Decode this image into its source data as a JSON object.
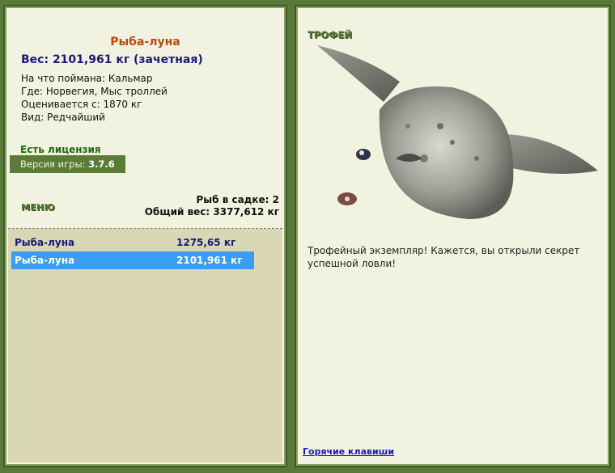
{
  "fish": {
    "name": "Рыба-луна",
    "weight_line": "Вес: 2101,961 кг (зачетная)",
    "bait_line": "На что поймана: Кальмар",
    "place_line": "Где: Норвегия, Мыс троллей",
    "value_line": "Оценивается с: 1870 кг",
    "kind_line": "Вид: Редчайший"
  },
  "license": "Есть лицензия",
  "version": {
    "label": "Версия игры:",
    "value": "3.7.6"
  },
  "menu_label": "МЕНЮ",
  "stats": {
    "fish_count": "Рыб в садке: 2",
    "total_weight": "Общий вес: 3377,612 кг"
  },
  "catch_list": [
    {
      "name": "Рыба-луна",
      "weight": "1275,65 кг",
      "selected": false
    },
    {
      "name": "Рыба-луна",
      "weight": "2101,961 кг",
      "selected": true
    }
  ],
  "trophy": {
    "label": "ТРОФЕЙ",
    "text": "Трофейный экземпляр! Кажется, вы открыли секрет успешной ловли!"
  },
  "hotkeys_link": "Горячие клавиши"
}
